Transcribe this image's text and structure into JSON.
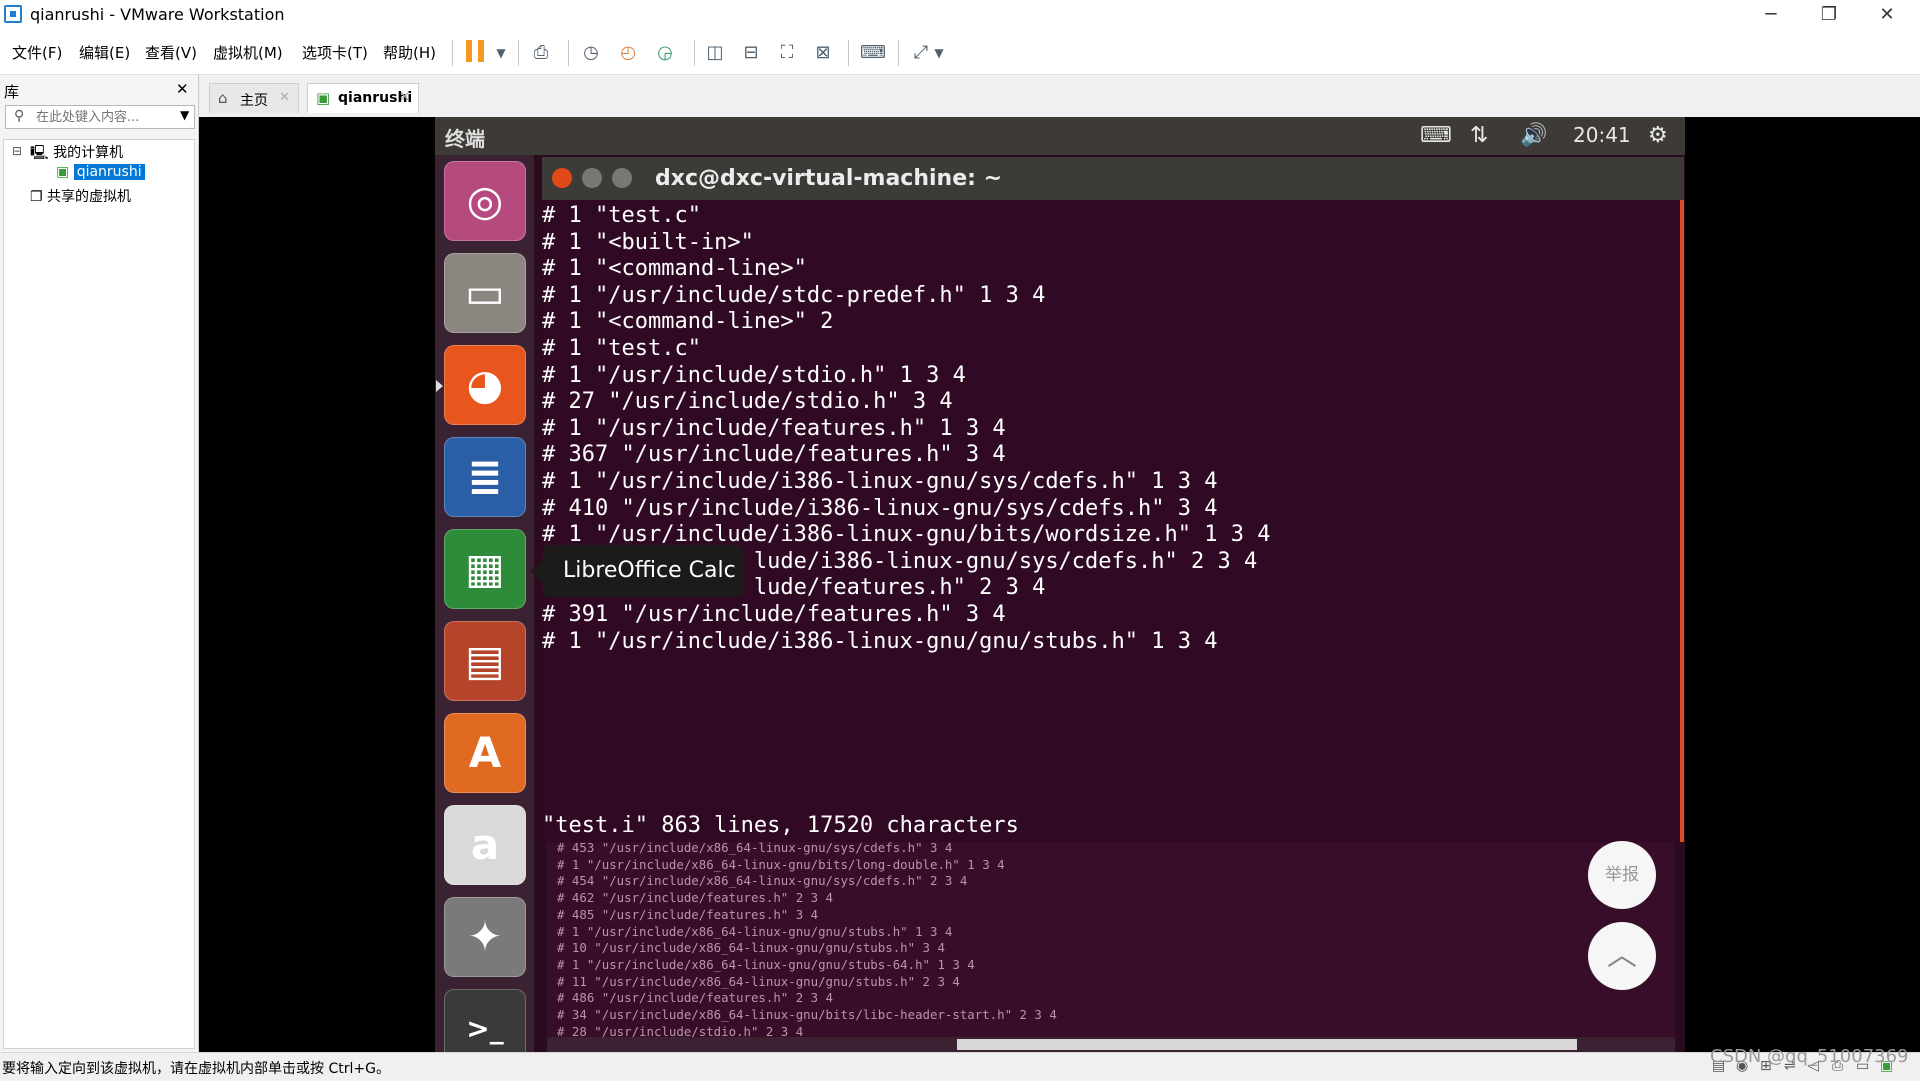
{
  "window": {
    "title": "qianrushi - VMware Workstation",
    "minimize_glyph": "─",
    "restore_glyph": "❐",
    "close_glyph": "✕"
  },
  "menu": [
    "文件(F)",
    "编辑(E)",
    "查看(V)",
    "虚拟机(M)",
    "选项卡(T)",
    "帮助(H)"
  ],
  "library": {
    "title": "库",
    "close_glyph": "✕",
    "search_placeholder": "在此处键入内容...",
    "tree": [
      {
        "toggle": "⊟",
        "label": "我的计算机"
      },
      {
        "label": "qianrushi",
        "selected": true
      },
      {
        "label": "共享的虚拟机"
      }
    ]
  },
  "tabs": [
    {
      "label": "主页"
    },
    {
      "label": "qianrushi",
      "active": true
    }
  ],
  "ubuntu": {
    "panel_title": "终端",
    "clock": "20:41",
    "tooltip": "LibreOffice Calc",
    "launcher": [
      {
        "name": "ubuntu-dash-icon",
        "glyph": "◎",
        "color": "#b54a7f"
      },
      {
        "name": "files-icon",
        "glyph": "▭",
        "color": "#8b8680"
      },
      {
        "name": "firefox-icon",
        "glyph": "◕",
        "color": "#e8561d"
      },
      {
        "name": "writer-icon",
        "glyph": "≣",
        "color": "#2a5fa8"
      },
      {
        "name": "calc-icon",
        "glyph": "▦",
        "color": "#2e8b3a"
      },
      {
        "name": "impress-icon",
        "glyph": "▤",
        "color": "#b5442a"
      },
      {
        "name": "software-center-icon",
        "glyph": "A",
        "color": "#e06a22"
      },
      {
        "name": "amazon-icon",
        "glyph": "a",
        "color": "#d9d9d9"
      },
      {
        "name": "system-settings-icon",
        "glyph": "✦",
        "color": "#7a7a7a"
      },
      {
        "name": "terminal-icon",
        "glyph": ">_",
        "color": "#3a3a3a"
      }
    ]
  },
  "terminal": {
    "title": "dxc@dxc-virtual-machine: ~",
    "lines": [
      "# 1 \"test.c\"",
      "# 1 \"<built-in>\"",
      "# 1 \"<command-line>\"",
      "# 1 \"/usr/include/stdc-predef.h\" 1 3 4",
      "# 1 \"<command-line>\" 2",
      "# 1 \"test.c\"",
      "# 1 \"/usr/include/stdio.h\" 1 3 4",
      "# 27 \"/usr/include/stdio.h\" 3 4",
      "# 1 \"/usr/include/features.h\" 1 3 4",
      "# 367 \"/usr/include/features.h\" 3 4",
      "# 1 \"/usr/include/i386-linux-gnu/sys/cdefs.h\" 1 3 4",
      "# 410 \"/usr/include/i386-linux-gnu/sys/cdefs.h\" 3 4",
      "# 1 \"/usr/include/i386-linux-gnu/bits/wordsize.h\" 1 3 4",
      "                lude/i386-linux-gnu/sys/cdefs.h\" 2 3 4",
      "                lude/features.h\" 2 3 4",
      "# 391 \"/usr/include/features.h\" 3 4",
      "# 1 \"/usr/include/i386-linux-gnu/gnu/stubs.h\" 1 3 4"
    ],
    "status": "\"test.i\" 863 lines, 17520 characters"
  },
  "bg_terminal": {
    "lines": [
      "# 453 \"/usr/include/x86_64-linux-gnu/sys/cdefs.h\" 3 4",
      "# 1 \"/usr/include/x86_64-linux-gnu/bits/long-double.h\" 1 3 4",
      "# 454 \"/usr/include/x86_64-linux-gnu/sys/cdefs.h\" 2 3 4",
      "# 462 \"/usr/include/features.h\" 2 3 4",
      "# 485 \"/usr/include/features.h\" 3 4",
      "# 1 \"/usr/include/x86_64-linux-gnu/gnu/stubs.h\" 1 3 4",
      "# 10 \"/usr/include/x86_64-linux-gnu/gnu/stubs.h\" 3 4",
      "# 1 \"/usr/include/x86_64-linux-gnu/gnu/stubs-64.h\" 1 3 4",
      "# 11 \"/usr/include/x86_64-linux-gnu/gnu/stubs.h\" 2 3 4",
      "# 486 \"/usr/include/features.h\" 2 3 4",
      "# 34 \"/usr/include/x86_64-linux-gnu/bits/libc-header-start.h\" 2 3 4",
      "# 28 \"/usr/include/stdio.h\" 2 3 4"
    ]
  },
  "overlay": {
    "report": "举报",
    "top_glyph": "︿"
  },
  "status": {
    "text": "要将输入定向到该虚拟机，请在虚拟机内部单击或按 Ctrl+G。",
    "watermark": "CSDN @qq_51007369"
  }
}
